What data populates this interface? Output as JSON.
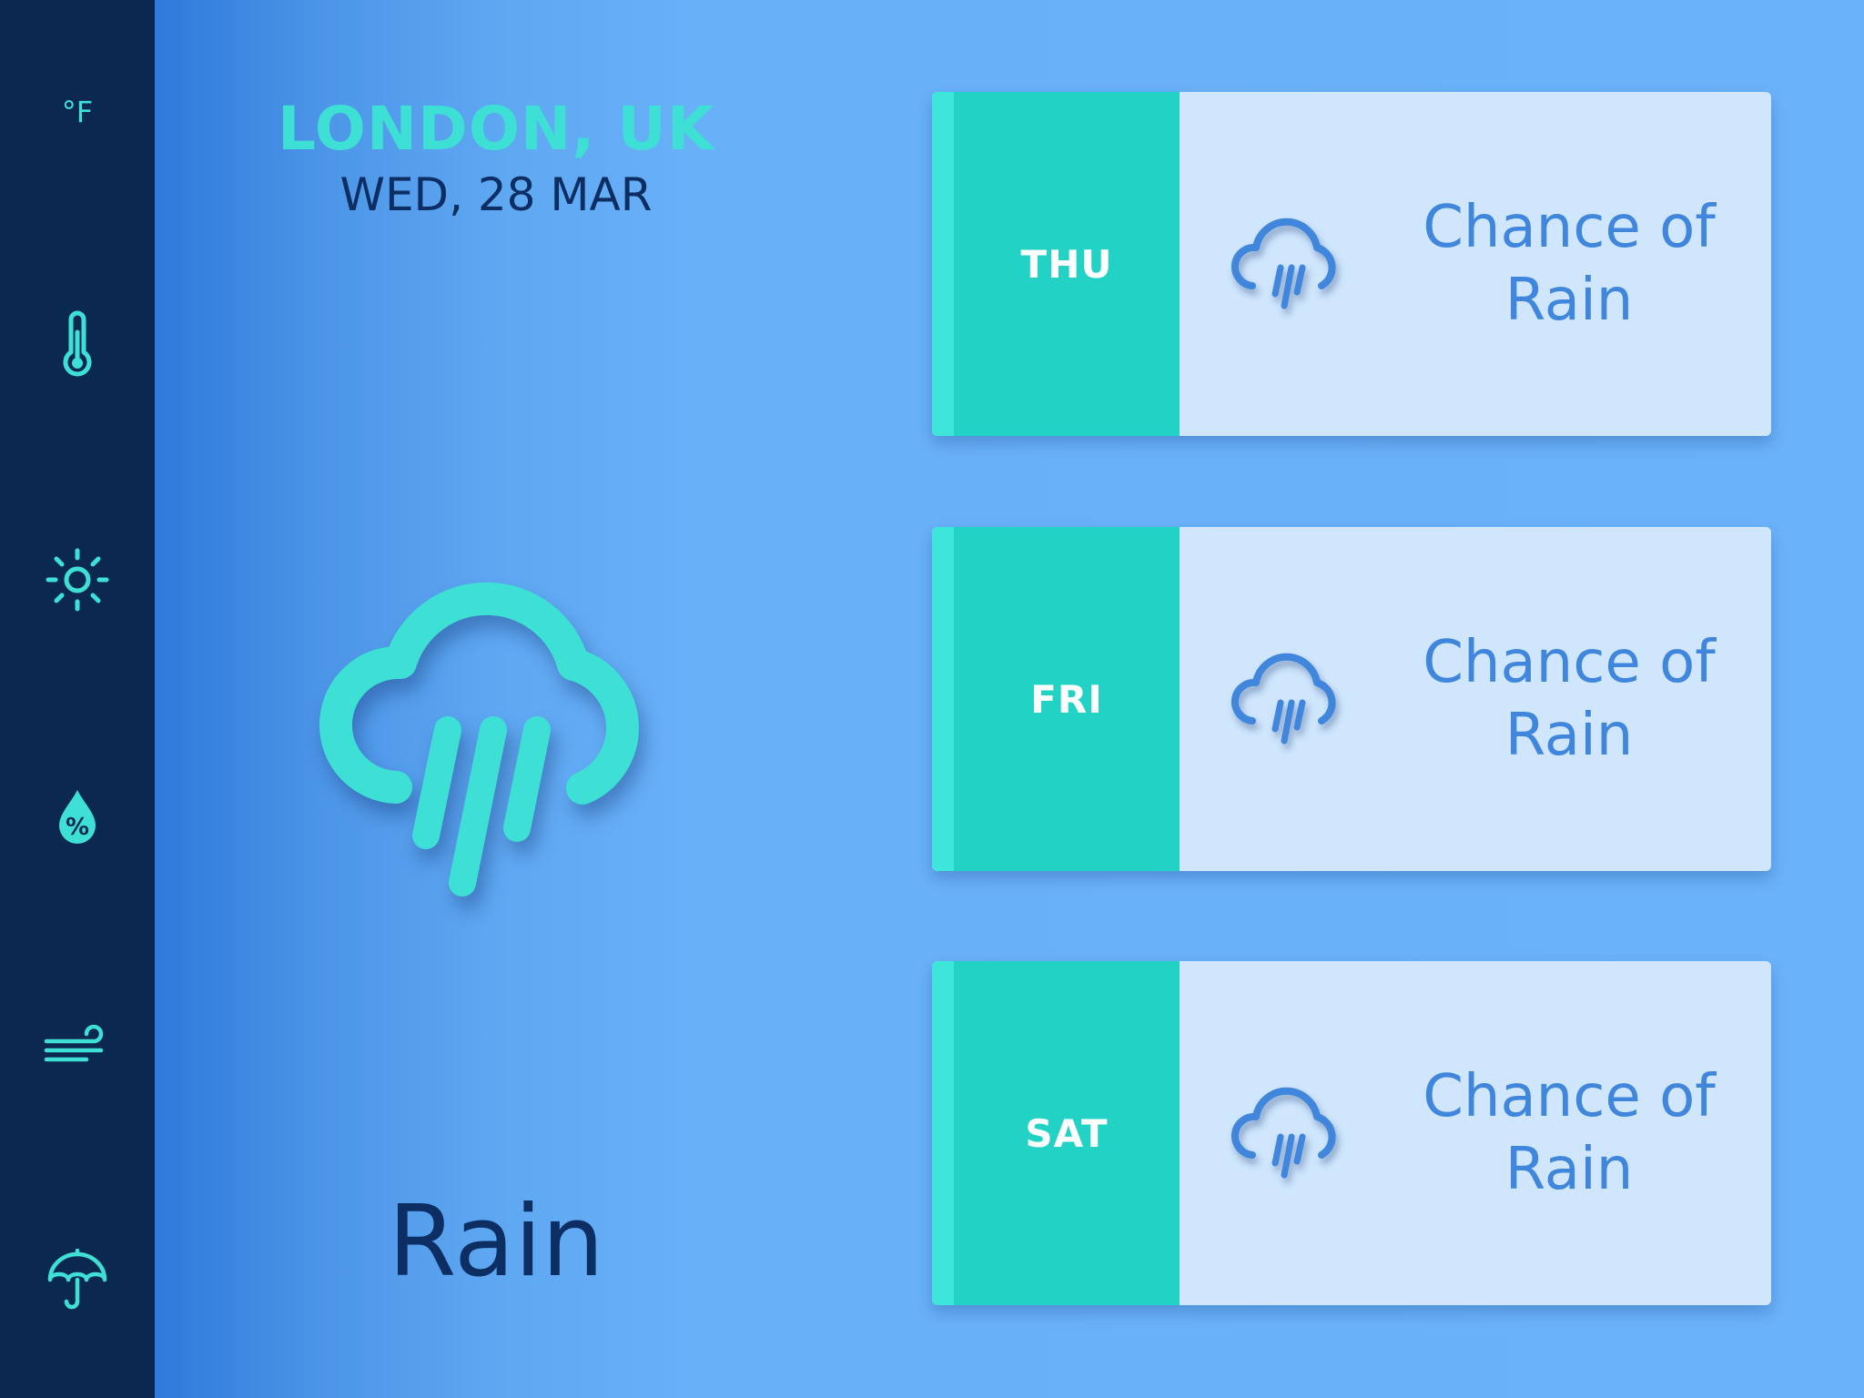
{
  "sidebar": {
    "unit_label": "°F",
    "icons": [
      "thermometer-icon",
      "sun-icon",
      "humidity-drop-icon",
      "wind-icon",
      "umbrella-icon"
    ]
  },
  "location": {
    "city": "LONDON, UK",
    "date": "WED, 28 MAR"
  },
  "current": {
    "condition": "Rain",
    "icon": "rain-cloud-icon"
  },
  "forecast": [
    {
      "day": "THU",
      "text": "Chance of Rain",
      "icon": "rain-cloud-icon"
    },
    {
      "day": "FRI",
      "text": "Chance of Rain",
      "icon": "rain-cloud-icon"
    },
    {
      "day": "SAT",
      "text": "Chance of Rain",
      "icon": "rain-cloud-icon"
    }
  ],
  "colors": {
    "accent": "#3ee0d6",
    "sidebar": "#0b2850",
    "day_panel": "#22d3c5",
    "card_bg": "#cfe6fd",
    "card_text": "#3f86dc",
    "dark_text": "#0c2e62"
  }
}
